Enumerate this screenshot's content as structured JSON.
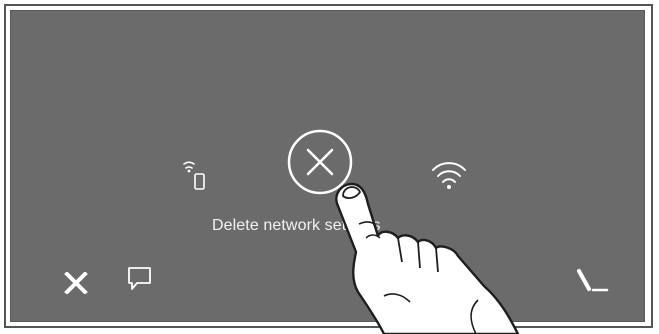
{
  "screen": {
    "caption": "Delete network settings",
    "icons": {
      "phone_wifi": "phone-wifi-icon",
      "delete": "close-circle-icon",
      "wifi": "wifi-icon",
      "close": "close-x-icon",
      "message": "message-icon",
      "edit": "pen-icon"
    },
    "colors": {
      "screen_bg": "#6b6b6b",
      "foreground": "#ffffff"
    }
  }
}
